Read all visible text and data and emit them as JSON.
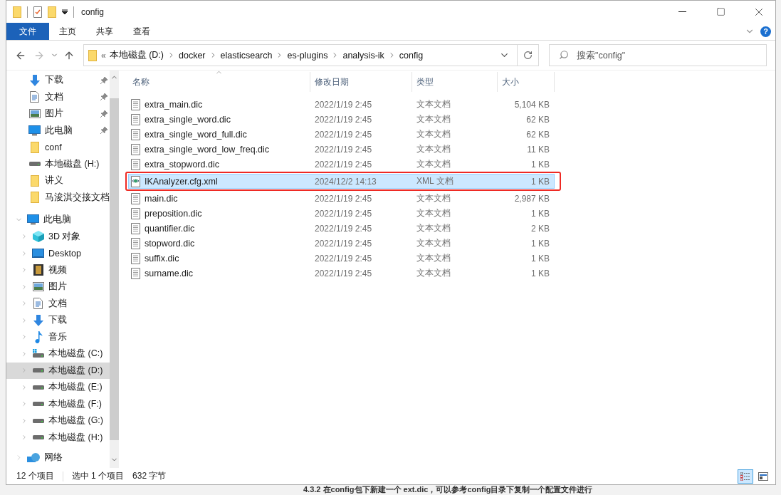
{
  "window": {
    "title": "config"
  },
  "ribbon_tabs": [
    {
      "label": "文件",
      "selected": true
    },
    {
      "label": "主页",
      "selected": false
    },
    {
      "label": "共享",
      "selected": false
    },
    {
      "label": "查看",
      "selected": false
    }
  ],
  "help_button": "?",
  "address": {
    "overflow": "«",
    "crumbs": [
      "本地磁盘 (D:)",
      "docker",
      "elasticsearch",
      "es-plugins",
      "analysis-ik",
      "config"
    ]
  },
  "search": {
    "placeholder": "搜索\"config\""
  },
  "sidebar": {
    "quick_access": [
      {
        "label": "下载",
        "kind": "download",
        "pinned": true
      },
      {
        "label": "文档",
        "kind": "document",
        "pinned": true
      },
      {
        "label": "图片",
        "kind": "pictures",
        "pinned": true
      },
      {
        "label": "此电脑",
        "kind": "pc",
        "pinned": true
      },
      {
        "label": "conf",
        "kind": "folder",
        "pinned": false
      },
      {
        "label": "本地磁盘 (H:)",
        "kind": "drive",
        "pinned": false
      },
      {
        "label": "讲义",
        "kind": "folder",
        "pinned": false
      },
      {
        "label": "马浚淇交接文档",
        "kind": "folder",
        "pinned": false
      }
    ],
    "this_pc": {
      "label": "此电脑",
      "expanded": true,
      "children": [
        {
          "label": "3D 对象",
          "kind": "cube",
          "selected": false
        },
        {
          "label": "Desktop",
          "kind": "desktop",
          "selected": false
        },
        {
          "label": "视频",
          "kind": "video",
          "selected": false
        },
        {
          "label": "图片",
          "kind": "pictures",
          "selected": false
        },
        {
          "label": "文档",
          "kind": "document",
          "selected": false
        },
        {
          "label": "下载",
          "kind": "download",
          "selected": false
        },
        {
          "label": "音乐",
          "kind": "music",
          "selected": false
        },
        {
          "label": "本地磁盘 (C:)",
          "kind": "system-drive",
          "selected": false
        },
        {
          "label": "本地磁盘 (D:)",
          "kind": "drive",
          "selected": true
        },
        {
          "label": "本地磁盘 (E:)",
          "kind": "drive",
          "selected": false
        },
        {
          "label": "本地磁盘 (F:)",
          "kind": "drive",
          "selected": false
        },
        {
          "label": "本地磁盘 (G:)",
          "kind": "drive",
          "selected": false
        },
        {
          "label": "本地磁盘 (H:)",
          "kind": "drive",
          "selected": false
        }
      ]
    },
    "network": {
      "label": "网络"
    }
  },
  "table": {
    "columns": [
      "名称",
      "修改日期",
      "类型",
      "大小"
    ],
    "rows": [
      {
        "name": "extra_main.dic",
        "modified": "2022/1/19 2:45",
        "type": "文本文档",
        "size": "5,104 KB",
        "kind": "text",
        "selected": false
      },
      {
        "name": "extra_single_word.dic",
        "modified": "2022/1/19 2:45",
        "type": "文本文档",
        "size": "62 KB",
        "kind": "text",
        "selected": false
      },
      {
        "name": "extra_single_word_full.dic",
        "modified": "2022/1/19 2:45",
        "type": "文本文档",
        "size": "62 KB",
        "kind": "text",
        "selected": false
      },
      {
        "name": "extra_single_word_low_freq.dic",
        "modified": "2022/1/19 2:45",
        "type": "文本文档",
        "size": "11 KB",
        "kind": "text",
        "selected": false
      },
      {
        "name": "extra_stopword.dic",
        "modified": "2022/1/19 2:45",
        "type": "文本文档",
        "size": "1 KB",
        "kind": "text",
        "selected": false
      },
      {
        "name": "IKAnalyzer.cfg.xml",
        "modified": "2024/12/2 14:13",
        "type": "XML 文档",
        "size": "1 KB",
        "kind": "xml",
        "selected": true
      },
      {
        "name": "main.dic",
        "modified": "2022/1/19 2:45",
        "type": "文本文档",
        "size": "2,987 KB",
        "kind": "text",
        "selected": false
      },
      {
        "name": "preposition.dic",
        "modified": "2022/1/19 2:45",
        "type": "文本文档",
        "size": "1 KB",
        "kind": "text",
        "selected": false
      },
      {
        "name": "quantifier.dic",
        "modified": "2022/1/19 2:45",
        "type": "文本文档",
        "size": "2 KB",
        "kind": "text",
        "selected": false
      },
      {
        "name": "stopword.dic",
        "modified": "2022/1/19 2:45",
        "type": "文本文档",
        "size": "1 KB",
        "kind": "text",
        "selected": false
      },
      {
        "name": "suffix.dic",
        "modified": "2022/1/19 2:45",
        "type": "文本文档",
        "size": "1 KB",
        "kind": "text",
        "selected": false
      },
      {
        "name": "surname.dic",
        "modified": "2022/1/19 2:45",
        "type": "文本文档",
        "size": "1 KB",
        "kind": "text",
        "selected": false
      }
    ]
  },
  "status_bar": [
    "12 个项目",
    "选中 1 个项目",
    "632 字节"
  ],
  "view_buttons": [
    {
      "kind": "details",
      "selected": true
    },
    {
      "kind": "large-icons",
      "selected": false
    }
  ],
  "background_heading": "4.3.2 在config包下新建一个 ext.dic，可以参考config目录下复制一个配置文件进行"
}
